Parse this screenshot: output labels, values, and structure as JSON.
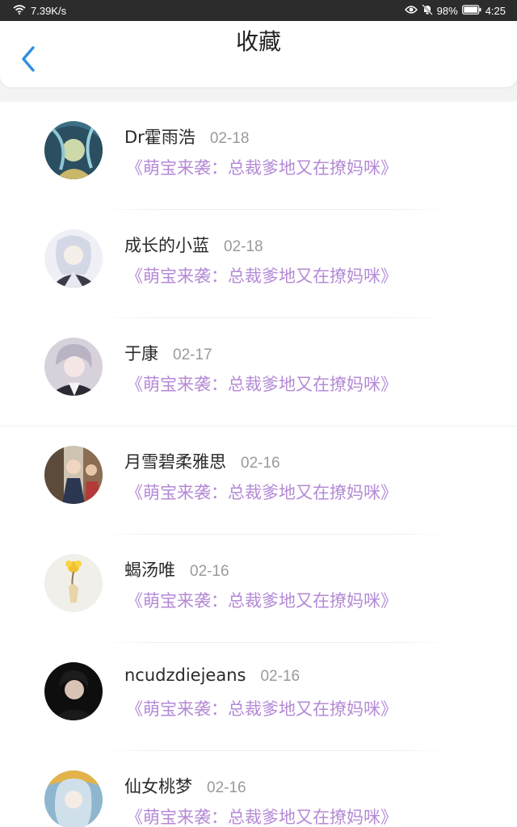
{
  "status_bar": {
    "net_speed": "7.39K/s",
    "battery": "98%",
    "time": "4:25"
  },
  "header": {
    "title": "收藏",
    "back_icon": "chevron-left-icon"
  },
  "colors": {
    "accent": "#2f8fe0",
    "title_link": "#b48ad6"
  },
  "items": [
    {
      "name": "Dr霍雨浩",
      "date": "02-18",
      "title": "《萌宝来袭：总裁爹地又在撩妈咪》"
    },
    {
      "name": "成长的小蓝",
      "date": "02-18",
      "title": "《萌宝来袭：总裁爹地又在撩妈咪》"
    },
    {
      "name": "于康",
      "date": "02-17",
      "title": "《萌宝来袭：总裁爹地又在撩妈咪》"
    },
    {
      "name": "月雪碧柔雅思",
      "date": "02-16",
      "title": "《萌宝来袭：总裁爹地又在撩妈咪》"
    },
    {
      "name": "蝎汤唯",
      "date": "02-16",
      "title": "《萌宝来袭：总裁爹地又在撩妈咪》"
    },
    {
      "name": "ncudzdiejeans",
      "date": "02-16",
      "title": "《萌宝来袭：总裁爹地又在撩妈咪》"
    },
    {
      "name": "仙女桃梦",
      "date": "02-16",
      "title": "《萌宝来袭：总裁爹地又在撩妈咪》"
    }
  ]
}
